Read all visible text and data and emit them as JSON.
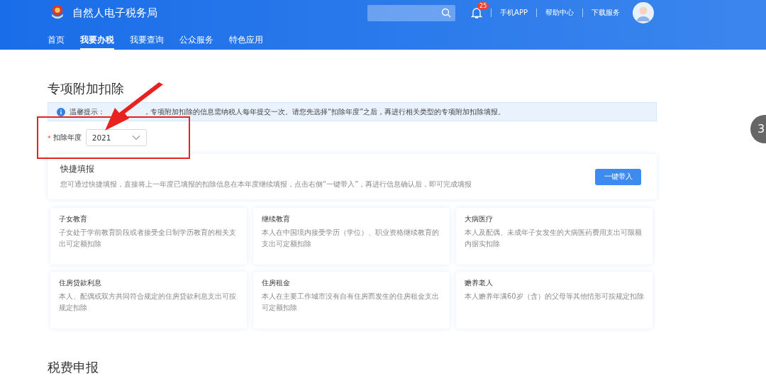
{
  "header": {
    "site_title": "自然人电子税务局",
    "notification_count": "25",
    "links": [
      "手机APP",
      "帮助中心",
      "下载服务"
    ]
  },
  "nav": [
    {
      "label": "首页",
      "selected": false
    },
    {
      "label": "我要办税",
      "selected": true
    },
    {
      "label": "我要查询",
      "selected": false
    },
    {
      "label": "公众服务",
      "selected": false
    },
    {
      "label": "特色应用",
      "selected": false
    }
  ],
  "section_title": "专项附加扣除",
  "notice": {
    "before_arrow": "温馨提示：",
    "after_arrow": "，专项附加扣除的信息需纳税人每年提交一次。请您先选择“扣除年度”之后，再进行相关类型的专项附加扣除填报。"
  },
  "year_field": {
    "label": "扣除年度",
    "required": true,
    "required_mark": "*",
    "value": "2021"
  },
  "quick_fill": {
    "title": "快捷填报",
    "description": "您可通过快捷填报，直接将上一年度已填报的扣除信息在本年度继续填报，点击右侧“一键带入”，再进行信息确认后，即可完成填报",
    "button": "一键带入"
  },
  "categories": [
    {
      "title": "子女教育",
      "description": "子女处于学前教育阶段或者接受全日制学历教育的相关支出可定额扣除"
    },
    {
      "title": "继续教育",
      "description": "本人在中国境内接受学历（学位）、职业资格继续教育的支出可定额扣除"
    },
    {
      "title": "大病医疗",
      "description": "本人及配偶、未成年子女发生的大病医药费用支出可限额内据实扣除"
    },
    {
      "title": "住房贷款利息",
      "description": "本人、配偶或双方共同符合规定的住房贷款利息支出可按规定扣除"
    },
    {
      "title": "住房租金",
      "description": "本人在主要工作城市没有自有住房而发生的住房租金支出可定额扣除"
    },
    {
      "title": "赡养老人",
      "description": "本人赡养年满60岁（含）的父母等其他情形可按规定扣除"
    }
  ],
  "next_section_title": "税费申报",
  "floating_button": "3"
}
